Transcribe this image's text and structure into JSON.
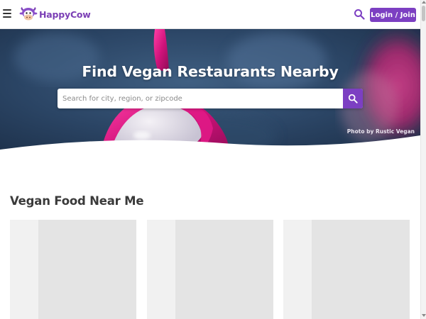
{
  "header": {
    "logo_text": "HappyCow",
    "login_label": "Login / Join"
  },
  "hero": {
    "title": "Find Vegan Restaurants Nearby",
    "search_placeholder": "Search for city, region, or zipcode",
    "photo_credit": "Photo by Rustic Vegan"
  },
  "section": {
    "title": "Vegan Food Near Me"
  },
  "colors": {
    "brand_purple": "#7c3fc2",
    "logo_purple": "#7b3fb5"
  },
  "icons": [
    "menu-icon",
    "happycow-logo-icon",
    "search-icon"
  ]
}
